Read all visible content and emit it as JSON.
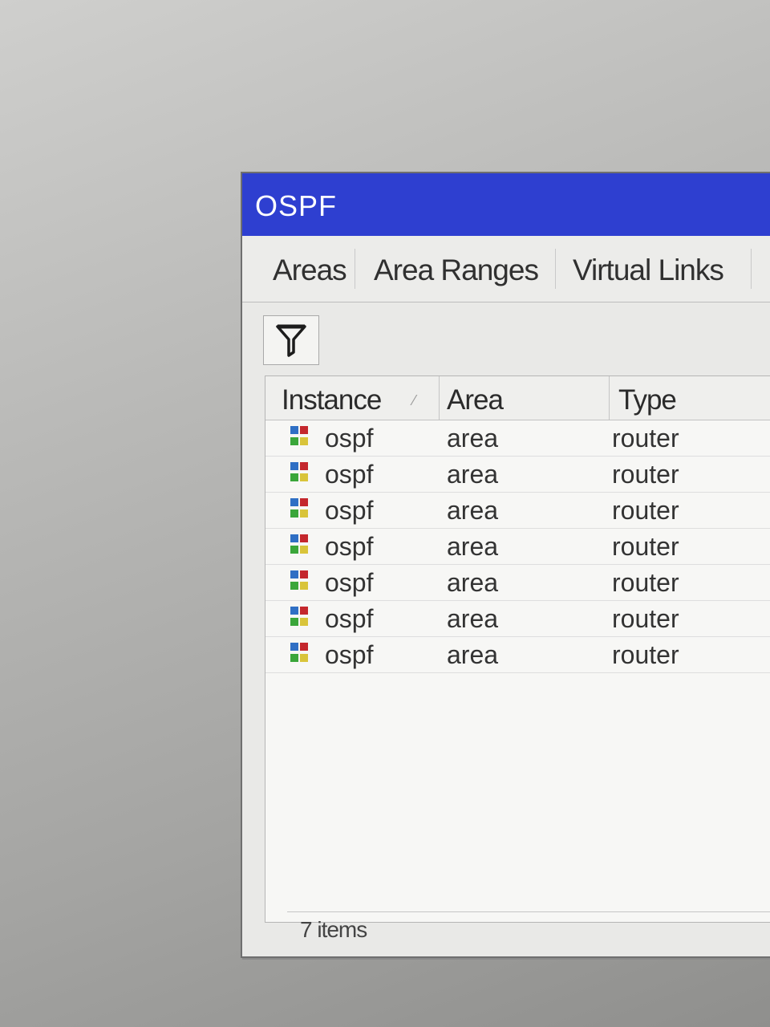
{
  "window": {
    "title": "OSPF"
  },
  "tabs": [
    {
      "label": "Areas"
    },
    {
      "label": "Area Ranges"
    },
    {
      "label": "Virtual Links"
    }
  ],
  "toolbar": {
    "filter_icon": "filter-icon"
  },
  "table": {
    "columns": [
      {
        "label": "Instance",
        "sorted": true
      },
      {
        "label": "Area"
      },
      {
        "label": "Type"
      }
    ],
    "rows": [
      {
        "icon": "ospf-instance-icon",
        "instance": "ospf",
        "area": "area",
        "type": "router"
      },
      {
        "icon": "ospf-instance-icon",
        "instance": "ospf",
        "area": "area",
        "type": "router"
      },
      {
        "icon": "ospf-instance-icon",
        "instance": "ospf",
        "area": "area",
        "type": "router"
      },
      {
        "icon": "ospf-instance-icon",
        "instance": "ospf",
        "area": "area",
        "type": "router"
      },
      {
        "icon": "ospf-instance-icon",
        "instance": "ospf",
        "area": "area",
        "type": "router"
      },
      {
        "icon": "ospf-instance-icon",
        "instance": "ospf",
        "area": "area",
        "type": "router"
      },
      {
        "icon": "ospf-instance-icon",
        "instance": "ospf",
        "area": "area",
        "type": "router"
      }
    ]
  },
  "status": {
    "items_text": "7 items"
  },
  "colors": {
    "titlebar": "#2e3fd0",
    "icon_blue": "#2f6fc4",
    "icon_red": "#c4272d",
    "icon_green": "#3aa63a",
    "icon_yellow": "#d9c43a"
  }
}
